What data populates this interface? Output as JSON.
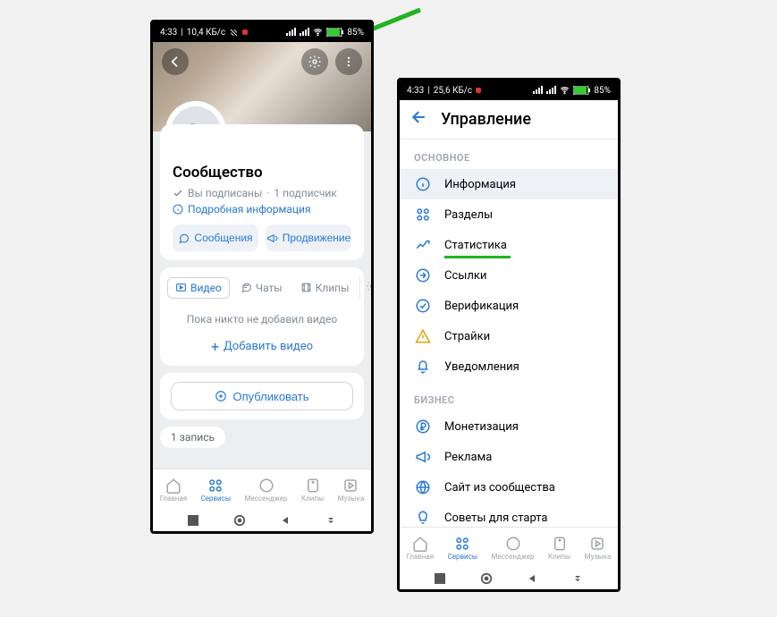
{
  "left": {
    "status": {
      "time": "4:33",
      "speed": "10,4 КБ/с",
      "battery": "85%"
    },
    "community_title": "Сообщество",
    "subscribed": "Вы подписаны",
    "followers": "1 подписчик",
    "info_link": "Подробная информация",
    "msg_btn": "Сообщения",
    "promo_btn": "Продвижение",
    "tabs": {
      "video": "Видео",
      "chats": "Чаты",
      "clips": "Клипы"
    },
    "empty_video": "Пока никто не добавил видео",
    "add_video": "Добавить видео",
    "publish": "Опубликовать",
    "records": "1 запись",
    "nav": {
      "home": "Главная",
      "services": "Сервисы",
      "messenger": "Мессенджер",
      "clips": "Клипы",
      "music": "Музыка"
    }
  },
  "right": {
    "status": {
      "time": "4:33",
      "speed": "25,6 КБ/с",
      "battery": "85%"
    },
    "title": "Управление",
    "section_main": "ОСНОВНОЕ",
    "items_main": {
      "info": "Информация",
      "sections": "Разделы",
      "stats": "Статистика",
      "links": "Ссылки",
      "verify": "Верификация",
      "strikes": "Страйки",
      "notif": "Уведомления"
    },
    "section_biz": "БИЗНЕС",
    "items_biz": {
      "monet": "Монетизация",
      "ads": "Реклама",
      "site": "Сайт из сообщества",
      "tips": "Советы для старта"
    },
    "nav": {
      "home": "Главная",
      "services": "Сервисы",
      "messenger": "Мессенджер",
      "clips": "Клипы",
      "music": "Музыка"
    }
  }
}
